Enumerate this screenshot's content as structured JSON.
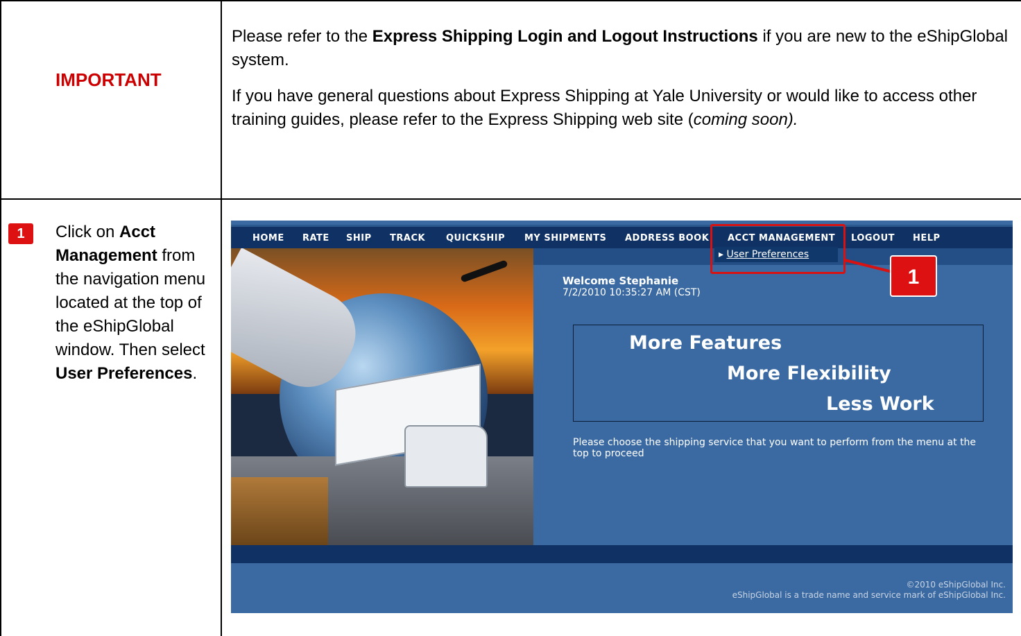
{
  "important": {
    "label": "IMPORTANT",
    "para1_pre": "Please refer to the ",
    "para1_bold": "Express Shipping Login and Logout Instructions",
    "para1_post": " if you are new to the eShipGlobal system.",
    "para2_pre": "If you have general questions about Express Shipping at Yale University or would like to access other training guides, please refer to the Express Shipping web site (",
    "para2_italic": "coming soon)."
  },
  "step1": {
    "badge": "1",
    "t1": "Click on ",
    "b1": "Acct Management",
    "t2": " from the navigation menu located at the top of the eShipGlobal window.  Then select ",
    "b2": "User Preferences",
    "t3": "."
  },
  "screenshot": {
    "nav": [
      "HOME",
      "RATE",
      "SHIP",
      "TRACK",
      "QUICKSHIP",
      "MY SHIPMENTS",
      "ADDRESS BOOK",
      "ACCT MANAGEMENT",
      "LOGOUT",
      "HELP"
    ],
    "submenu_item": "User Preferences",
    "callout": "1",
    "welcome_name": "Welcome Stephanie",
    "welcome_date": "7/2/2010 10:35:27 AM (CST)",
    "feature1": "More Features",
    "feature2": "More Flexibility",
    "feature3": "Less Work",
    "choose_text": "Please choose the shipping service that you want to perform from the menu at the top to proceed",
    "footer1": "©2010 eShipGlobal Inc.",
    "footer2": "eShipGlobal is a trade name and service mark of eShipGlobal Inc."
  },
  "colors": {
    "important_red": "#cc0000",
    "nav_bg": "#0f3163",
    "page_bg": "#3b6aa2",
    "highlight_red": "#d81111"
  }
}
